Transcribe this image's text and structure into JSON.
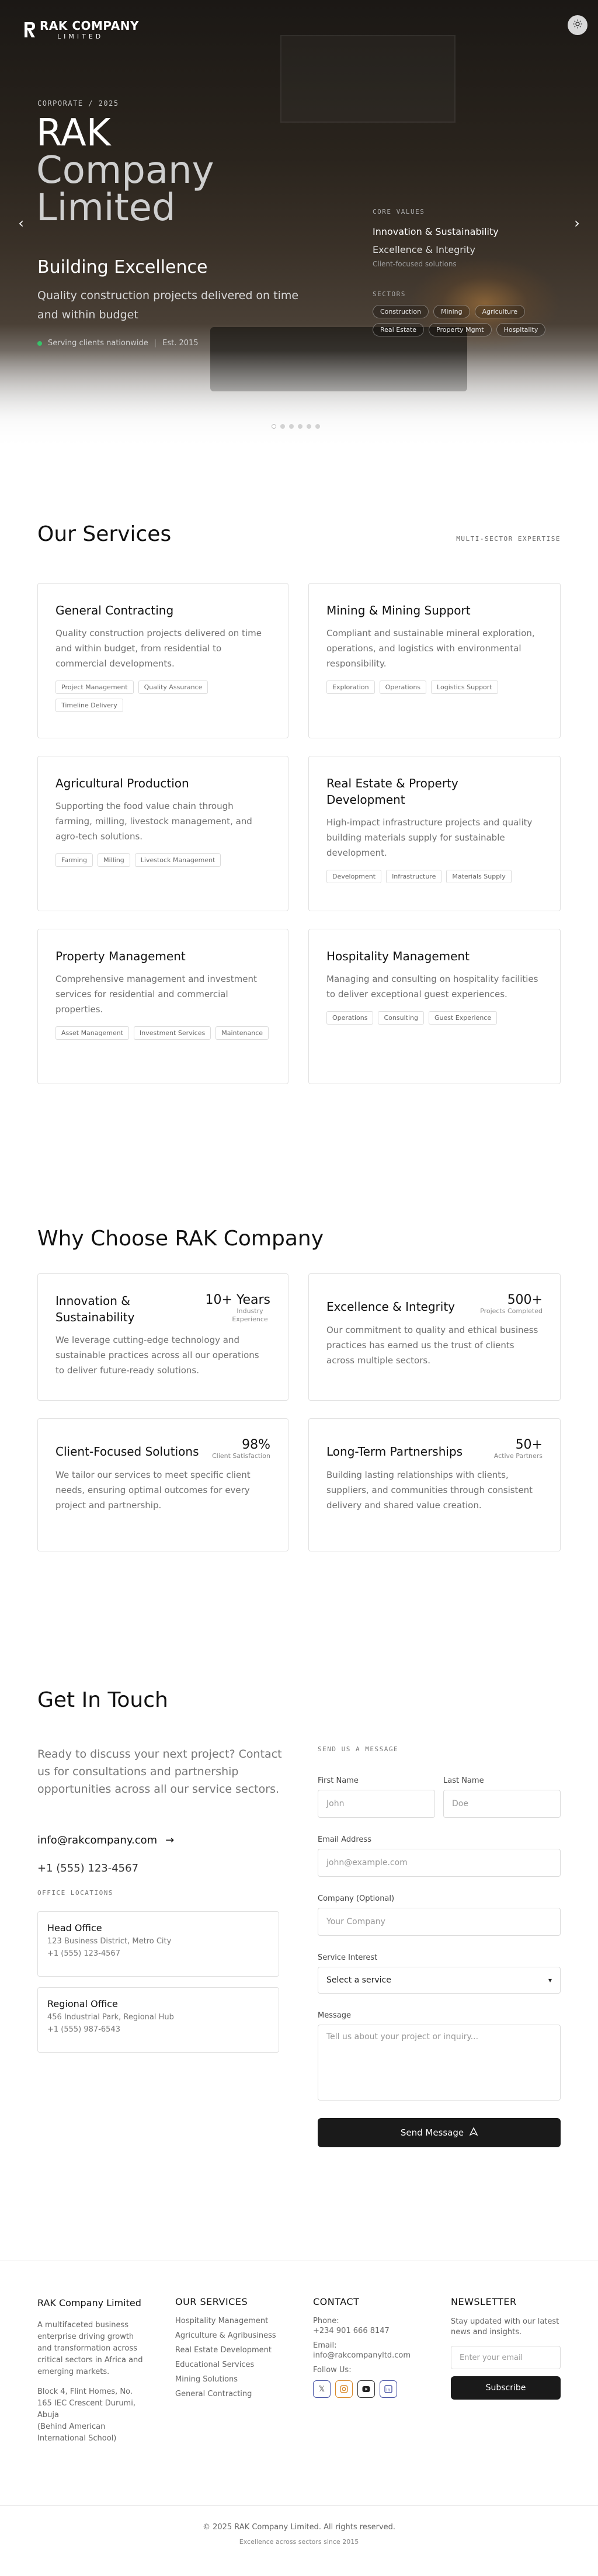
{
  "header": {
    "logo_name": "RAK COMPANY",
    "logo_sub": "LIMITED",
    "theme_toggle_icon": "sun-icon"
  },
  "hero": {
    "kicker": "CORPORATE / 2025",
    "title_line1": "RAK",
    "title_line2": "Company",
    "title_line3": "Limited",
    "subtitle": "Building Excellence",
    "description": "Quality construction projects delivered on time and within budget",
    "status": "Serving clients nationwide",
    "established": "Est. 2015",
    "core_values_label": "CORE VALUES",
    "core_values": [
      "Innovation & Sustainability",
      "Excellence & Integrity",
      "Client-focused solutions"
    ],
    "sectors_label": "SECTORS",
    "sectors": [
      "Construction",
      "Mining",
      "Agriculture",
      "Real Estate",
      "Property Mgmt",
      "Hospitality"
    ],
    "slide_count": 6,
    "active_slide": 1,
    "prev_icon": "chevron-left-icon",
    "next_icon": "chevron-right-icon"
  },
  "services": {
    "title": "Our Services",
    "tagline": "MULTI-SECTOR EXPERTISE",
    "items": [
      {
        "title": "General Contracting",
        "desc": "Quality construction projects delivered on time and within budget, from residential to commercial developments.",
        "tags": [
          "Project Management",
          "Quality Assurance",
          "Timeline Delivery"
        ]
      },
      {
        "title": "Mining & Mining Support",
        "desc": "Compliant and sustainable mineral exploration, operations, and logistics with environmental responsibility.",
        "tags": [
          "Exploration",
          "Operations",
          "Logistics Support"
        ]
      },
      {
        "title": "Agricultural Production",
        "desc": "Supporting the food value chain through farming, milling, livestock management, and agro-tech solutions.",
        "tags": [
          "Farming",
          "Milling",
          "Livestock Management"
        ]
      },
      {
        "title": "Real Estate & Property Development",
        "desc": "High-impact infrastructure projects and quality building materials supply for sustainable development.",
        "tags": [
          "Development",
          "Infrastructure",
          "Materials Supply"
        ]
      },
      {
        "title": "Property Management",
        "desc": "Comprehensive management and investment services for residential and commercial properties.",
        "tags": [
          "Asset Management",
          "Investment Services",
          "Maintenance"
        ]
      },
      {
        "title": "Hospitality Management",
        "desc": "Managing and consulting on hospitality facilities to deliver exceptional guest experiences.",
        "tags": [
          "Operations",
          "Consulting",
          "Guest Experience"
        ]
      }
    ]
  },
  "why": {
    "title": "Why Choose RAK Company",
    "items": [
      {
        "title": "Innovation & Sustainability",
        "stat": "10+ Years",
        "stat_label": "Industry Experience",
        "desc": "We leverage cutting-edge technology and sustainable practices across all our operations to deliver future-ready solutions."
      },
      {
        "title": "Excellence & Integrity",
        "stat": "500+",
        "stat_label": "Projects Completed",
        "desc": "Our commitment to quality and ethical business practices has earned us the trust of clients across multiple sectors."
      },
      {
        "title": "Client-Focused Solutions",
        "stat": "98%",
        "stat_label": "Client Satisfaction",
        "desc": "We tailor our services to meet specific client needs, ensuring optimal outcomes for every project and partnership."
      },
      {
        "title": "Long-Term Partnerships",
        "stat": "50+",
        "stat_label": "Active Partners",
        "desc": "Building lasting relationships with clients, suppliers, and communities through consistent delivery and shared value creation."
      }
    ]
  },
  "contact": {
    "title": "Get In Touch",
    "intro": "Ready to discuss your next project? Contact us for consultations and partnership opportunities across all our service sectors.",
    "email": "info@rakcompany.com",
    "email_arrow_icon": "arrow-right-icon",
    "phone": "+1 (555) 123-4567",
    "offices_label": "OFFICE LOCATIONS",
    "offices": [
      {
        "name": "Head Office",
        "address": "123 Business District, Metro City",
        "phone": "+1 (555) 123-4567"
      },
      {
        "name": "Regional Office",
        "address": "456 Industrial Park, Regional Hub",
        "phone": "+1 (555) 987-6543"
      }
    ],
    "form": {
      "label": "SEND US A MESSAGE",
      "first_name_label": "First Name",
      "first_name_placeholder": "John",
      "last_name_label": "Last Name",
      "last_name_placeholder": "Doe",
      "email_label": "Email Address",
      "email_placeholder": "john@example.com",
      "company_label": "Company (Optional)",
      "company_placeholder": "Your Company",
      "service_label": "Service Interest",
      "service_value": "Select a service",
      "message_label": "Message",
      "message_placeholder": "Tell us about your project or inquiry...",
      "submit_label": "Send Message",
      "submit_icon": "send-icon"
    }
  },
  "footer": {
    "company_name": "RAK Company Limited",
    "company_desc": "A multifaceted business enterprise driving growth and transformation across critical sectors in Africa and emerging markets.",
    "address": "Block 4, Flint Homes, No. 165 IEC Crescent Durumi, Abuja",
    "address_note": "(Behind American International School)",
    "services_title": "OUR SERVICES",
    "services": [
      "Hospitality Management",
      "Agriculture & Agribusiness",
      "Real Estate Development",
      "Educational Services",
      "Mining Solutions",
      "General Contracting"
    ],
    "contact_title": "CONTACT",
    "phone_label": "Phone:",
    "phone": "+234 901 666 8147",
    "email_label": "Email:",
    "email": "info@rakcompanyltd.com",
    "follow_label": "Follow Us:",
    "socials": [
      "x-icon",
      "instagram-icon",
      "youtube-icon",
      "linkedin-icon"
    ],
    "newsletter_title": "NEWSLETTER",
    "newsletter_desc": "Stay updated with our latest news and insights.",
    "newsletter_placeholder": "Enter your email",
    "subscribe_label": "Subscribe",
    "copyright": "© 2025 RAK Company Limited. All rights reserved.",
    "tagline": "Excellence across sectors since 2015"
  },
  "colors": {
    "accent_dark": "#1a1a1a",
    "status_green": "#37c36a"
  }
}
